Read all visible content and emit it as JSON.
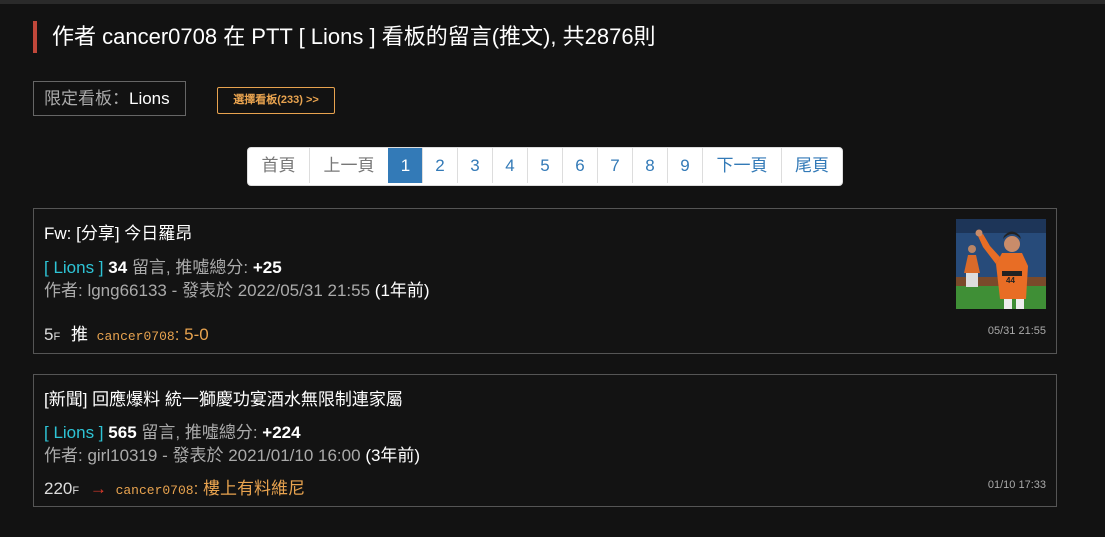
{
  "header": {
    "title": "作者 cancer0708 在 PTT [ Lions ] 看板的留言(推文), 共2876則"
  },
  "filter": {
    "label": "限定看板：",
    "value": "Lions",
    "select_button": "選擇看板(233) >>"
  },
  "pagination": {
    "items": [
      "首頁",
      "上一頁",
      "1",
      "2",
      "3",
      "4",
      "5",
      "6",
      "7",
      "8",
      "9",
      "下一頁",
      "尾頁"
    ],
    "active": "1"
  },
  "posts": [
    {
      "title": "Fw: [分享] 今日羅昂",
      "board": "[ Lions ]",
      "comment_count": "34",
      "comment_label": "留言, 推噓總分:",
      "score": "+25",
      "author_line": "作者: lgng66133 - 發表於 2022/05/31 21:55",
      "ago": "(1年前)",
      "floor": "5",
      "floor_suffix": "F",
      "reply_type": "推",
      "user": "cancer0708",
      "content": "5-0",
      "time": "05/31 21:55",
      "thumbnail_number": "44"
    },
    {
      "title": "[新聞] 回應爆料 統一獅慶功宴酒水無限制連家屬",
      "board": "[ Lions ]",
      "comment_count": "565",
      "comment_label": "留言, 推噓總分:",
      "score": "+224",
      "author_line": "作者: girl10319 - 發表於 2021/01/10 16:00",
      "ago": "(3年前)",
      "floor": "220",
      "floor_suffix": "F",
      "reply_type": "→",
      "user": "cancer0708",
      "content": "樓上有料維尼",
      "time": "01/10 17:33"
    }
  ],
  "colors": {
    "background": "#121212",
    "title_accent": "#c0473a",
    "board_tag": "#2ec4d6",
    "user_content": "#e8a34f",
    "arrow": "#e23b2c",
    "pager_active": "#337ab7"
  }
}
